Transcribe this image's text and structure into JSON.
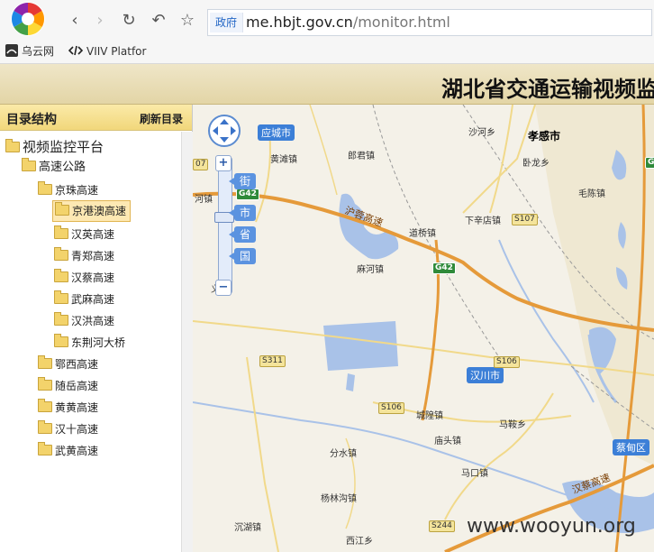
{
  "browser": {
    "nav_back": "‹",
    "nav_forward": "›",
    "nav_reload": "↻",
    "nav_undo": "↶",
    "nav_star": "☆",
    "gov_badge": "政府",
    "url_host": "me.hbjt.gov.cn",
    "url_path": "/monitor.html"
  },
  "bookmarks": [
    {
      "label": "乌云网",
      "icon": "wooyun-icon"
    },
    {
      "label": "VIIV Platfor",
      "icon": "code-icon"
    }
  ],
  "banner": {
    "title": "湖北省交通运输视频监"
  },
  "sidebar": {
    "title": "目录结构",
    "refresh": "刷新目录",
    "tree": {
      "root": "视频监控平台",
      "highway": "高速公路",
      "jingzhu": "京珠高速",
      "jingzhu_children": [
        "京港澳高速",
        "汉英高速",
        "青郑高速",
        "汉蔡高速",
        "武麻高速",
        "汉洪高速",
        "东荆河大桥"
      ],
      "others": [
        "鄂西高速",
        "随岳高速",
        "黄黄高速",
        "汉十高速",
        "武黄高速"
      ]
    }
  },
  "map": {
    "zoom_tags": [
      "街",
      "市",
      "省",
      "国"
    ],
    "zoom_in": "+",
    "zoom_out": "−",
    "labels": {
      "yingcheng": "应城市",
      "xiaogan": "孝感市",
      "hanchuan": "汉川市",
      "caidian": "蔡甸区",
      "huangtan": "黄滩镇",
      "langjun": "郎君镇",
      "shahe": "沙河乡",
      "wolong": "卧龙乡",
      "maochen": "毛陈镇",
      "xiaxindian": "下辛店镇",
      "daoqiao": "道桥镇",
      "mahe": "麻河镇",
      "he": "河镇",
      "yi": "义",
      "chenglong": "城隍镇",
      "mianzhen": "马鞍乡",
      "miaotou": "庙头镇",
      "fenshui": "分水镇",
      "makou": "马口镇",
      "yanglingou": "杨林沟镇",
      "chenliu": "沉湖镇",
      "xijiang": "西江乡"
    },
    "highways": {
      "hurong": "沪蓉高速",
      "hancai": "汉蔡高速"
    },
    "shields": {
      "g42a": "G42",
      "g42b": "G42",
      "gright": "G",
      "s107": "S107",
      "s311": "S311",
      "s106a": "S106",
      "s106b": "S106",
      "s244": "S244",
      "n07": "07"
    }
  },
  "watermark": "www.wooyun.org"
}
